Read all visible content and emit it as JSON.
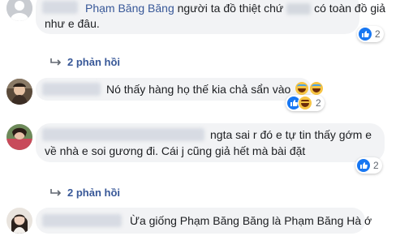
{
  "comments": [
    {
      "id": "c1",
      "author": "Phạm Băng Băng",
      "text_before_blur": "người ta đồ thiệt chứ",
      "text_after_blur": "có toàn đồ giả",
      "line2": "như e đâu.",
      "likes": "2"
    },
    {
      "id": "c2",
      "text": "Nó thấy hàng họ thế kia chả sẩn vào",
      "likes": "2"
    },
    {
      "id": "c3",
      "line1": "ngta sai r đó e tự tin thấy gớm e",
      "line2": "về nhà e soi gương đi. Cái j cũng giả hết mà bài đặt",
      "likes": "2"
    },
    {
      "id": "c4",
      "text": "Ừa giống Phạm Băng Băng là Phạm Băng Hà ớ"
    }
  ],
  "reply_threads": [
    {
      "label": "2 phản hồi"
    },
    {
      "label": "2 phản hồi"
    }
  ],
  "colors": {
    "link": "#385898",
    "bubble": "#f2f3f5",
    "like_blue": "#1877f2"
  }
}
